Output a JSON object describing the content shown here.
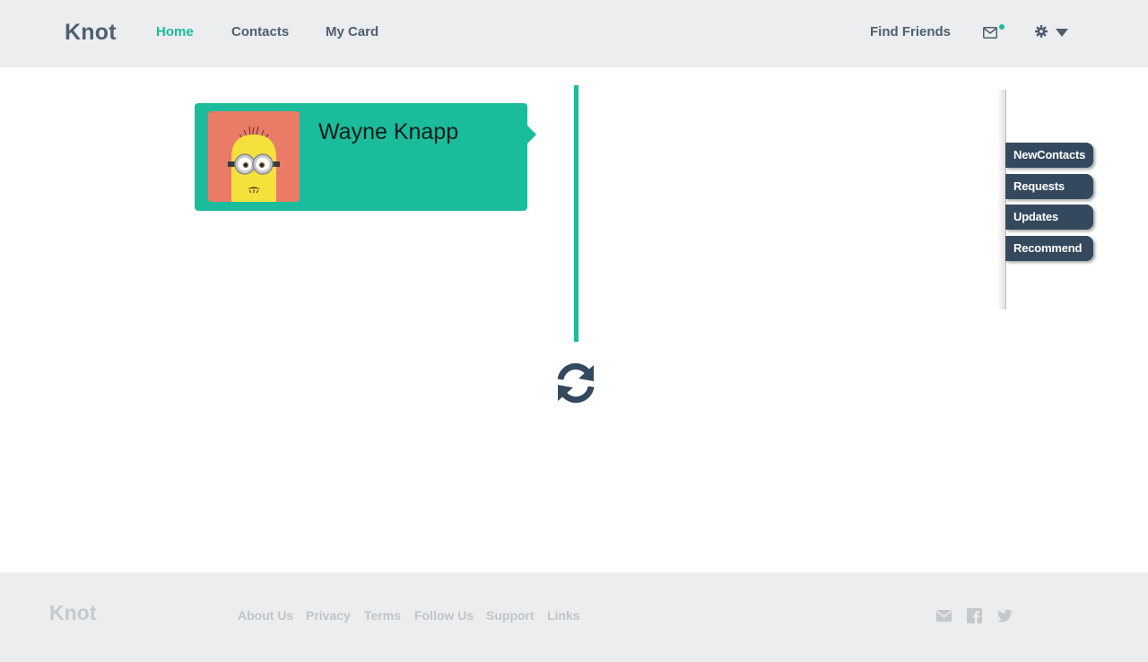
{
  "header": {
    "brand": "Knot",
    "nav": {
      "home": "Home",
      "contacts": "Contacts",
      "my_card": "My Card",
      "find_friends": "Find Friends"
    },
    "icons": [
      "mail-icon",
      "gear-icon",
      "caret-down-icon"
    ],
    "notification_dot_color": "#1abc9c"
  },
  "card": {
    "name": "Wayne Knapp",
    "background": "#1abc9c"
  },
  "side_panel": {
    "buttons": [
      "NewContacts",
      "Requests",
      "Updates",
      "Recommend"
    ]
  },
  "footer": {
    "brand": "Knot",
    "links": [
      "About Us",
      "Privacy",
      "Terms",
      "Follow Us",
      "Support",
      "Links"
    ],
    "icons": [
      "mail-icon",
      "facebook-icon",
      "twitter-icon"
    ]
  },
  "colors": {
    "accent": "#1abc9c",
    "dark": "#34495e",
    "header_bg": "#ebedef"
  }
}
